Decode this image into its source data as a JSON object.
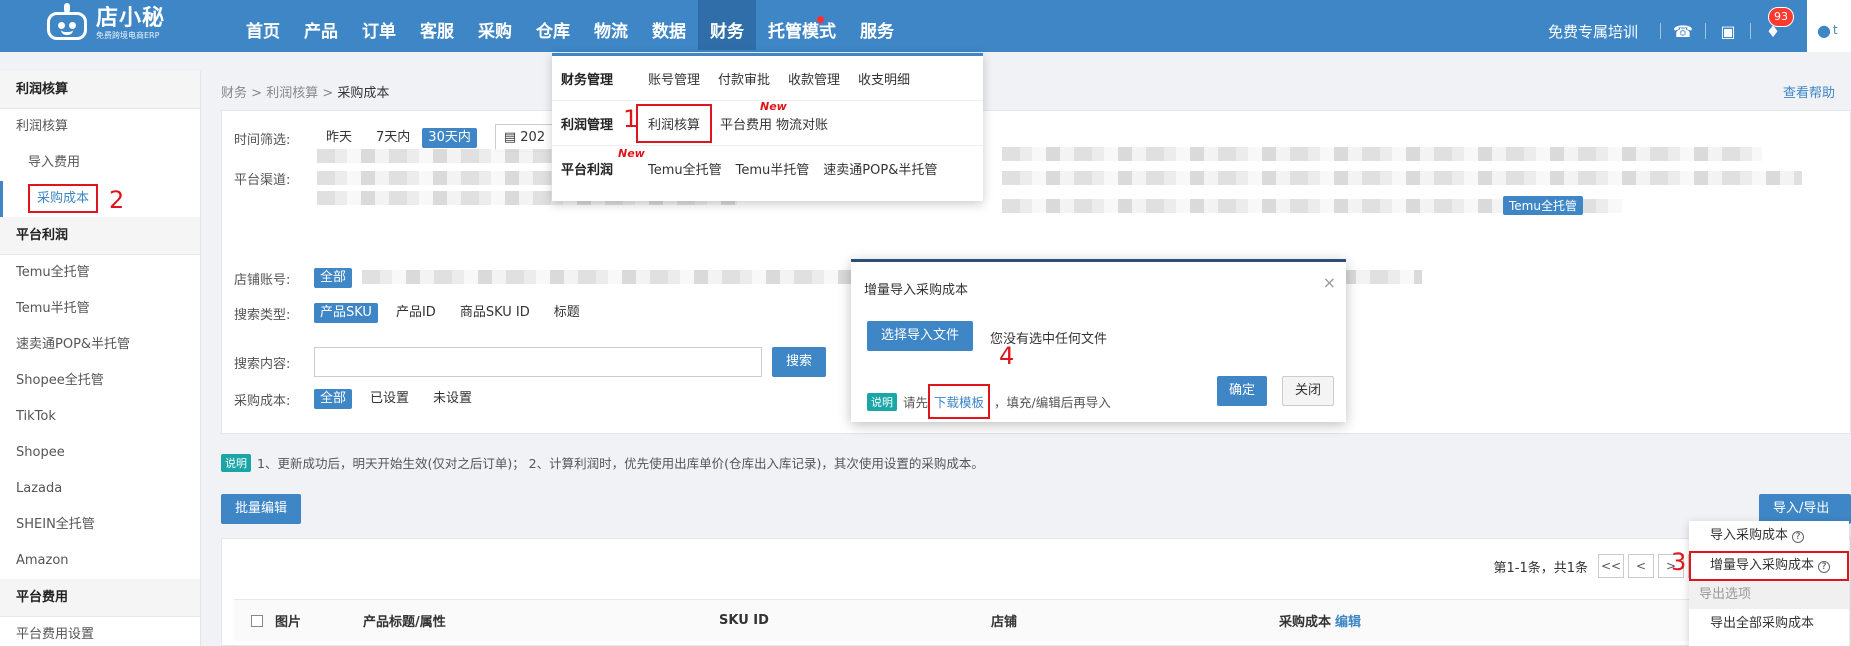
{
  "brand": {
    "name": "店小秘",
    "slogan": "免费跨境电商ERP"
  },
  "nav": {
    "items": [
      "首页",
      "产品",
      "订单",
      "客服",
      "采购",
      "仓库",
      "物流",
      "数据",
      "财务",
      "托管模式",
      "服务"
    ],
    "active": "财务"
  },
  "topbar": {
    "training": "免费专属培训",
    "notification_count": "93",
    "user_initial": "t"
  },
  "sidebar": {
    "sections": [
      {
        "title": "利润核算",
        "items": [
          "利润核算",
          "导入费用",
          "采购成本"
        ]
      },
      {
        "title": "平台利润",
        "items": [
          "Temu全托管",
          "Temu半托管",
          "速卖通POP&半托管",
          "Shopee全托管",
          "TikTok",
          "Shopee",
          "Lazada",
          "SHEIN全托管",
          "Amazon"
        ]
      },
      {
        "title": "平台费用",
        "items": [
          "平台费用设置"
        ]
      }
    ],
    "current": "采购成本"
  },
  "breadcrumb": [
    "财务",
    "利润核算",
    "采购成本"
  ],
  "help_link": "查看帮助",
  "filters": {
    "time_label": "时间筛选:",
    "time_options": [
      "昨天",
      "7天内",
      "30天内"
    ],
    "time_selected": "30天内",
    "date_value": "202",
    "channel_label": "平台渠道:",
    "channel_tag": "Temu全托管",
    "store_label": "店铺账号:",
    "store_all": "全部",
    "search_type_label": "搜索类型:",
    "search_types": [
      "产品SKU",
      "产品ID",
      "商品SKU ID",
      "标题"
    ],
    "search_type_selected": "产品SKU",
    "search_content_label": "搜索内容:",
    "search_value": "",
    "search_button": "搜索",
    "cost_label": "采购成本:",
    "cost_options": [
      "全部",
      "已设置",
      "未设置"
    ],
    "cost_selected": "全部"
  },
  "note": {
    "tag": "说明",
    "text": "1、更新成功后，明天开始生效(仅对之后订单)；  2、计算利润时，优先使用出库单价(仓库出入库记录)，其次使用设置的采购成本。"
  },
  "toolbar": {
    "batch_edit": "批量编辑",
    "import_export": "导入/导出"
  },
  "pager": {
    "summary": "第1-1条，共1条",
    "buttons": [
      "<<",
      "<",
      ">",
      ">>"
    ]
  },
  "table": {
    "columns": [
      "图片",
      "产品标题/属性",
      "SKU ID",
      "店铺",
      "采购成本"
    ],
    "cost_edit": "编辑"
  },
  "mega_menu": {
    "rows": [
      {
        "header": "财务管理",
        "items": [
          "账号管理",
          "付款审批",
          "收款管理",
          "收支明细"
        ]
      },
      {
        "header": "利润管理",
        "items": [
          "利润核算",
          "平台费用",
          "物流对账"
        ]
      },
      {
        "header": "平台利润",
        "items": [
          "Temu全托管",
          "Temu半托管",
          "速卖通POP&半托管"
        ]
      }
    ],
    "new_label": "New"
  },
  "modal": {
    "title": "增量导入采购成本",
    "choose_file": "选择导入文件",
    "no_file": "您没有选中任何文件",
    "help_tag": "说明",
    "help_prefix": "请先",
    "download_link": "下载模板",
    "help_suffix": "，填充/编辑后再导入",
    "ok": "确定",
    "close": "关闭"
  },
  "ie_menu": {
    "import_cost": "导入采购成本",
    "incremental_import": "增量导入采购成本",
    "export_group": "导出选项",
    "export_all": "导出全部采购成本"
  },
  "annotations": [
    "1",
    "2",
    "3",
    "4"
  ],
  "colors": {
    "primary": "#3e86c6",
    "highlight": "#e0151b",
    "modal_bar": "#2a4f7a"
  }
}
